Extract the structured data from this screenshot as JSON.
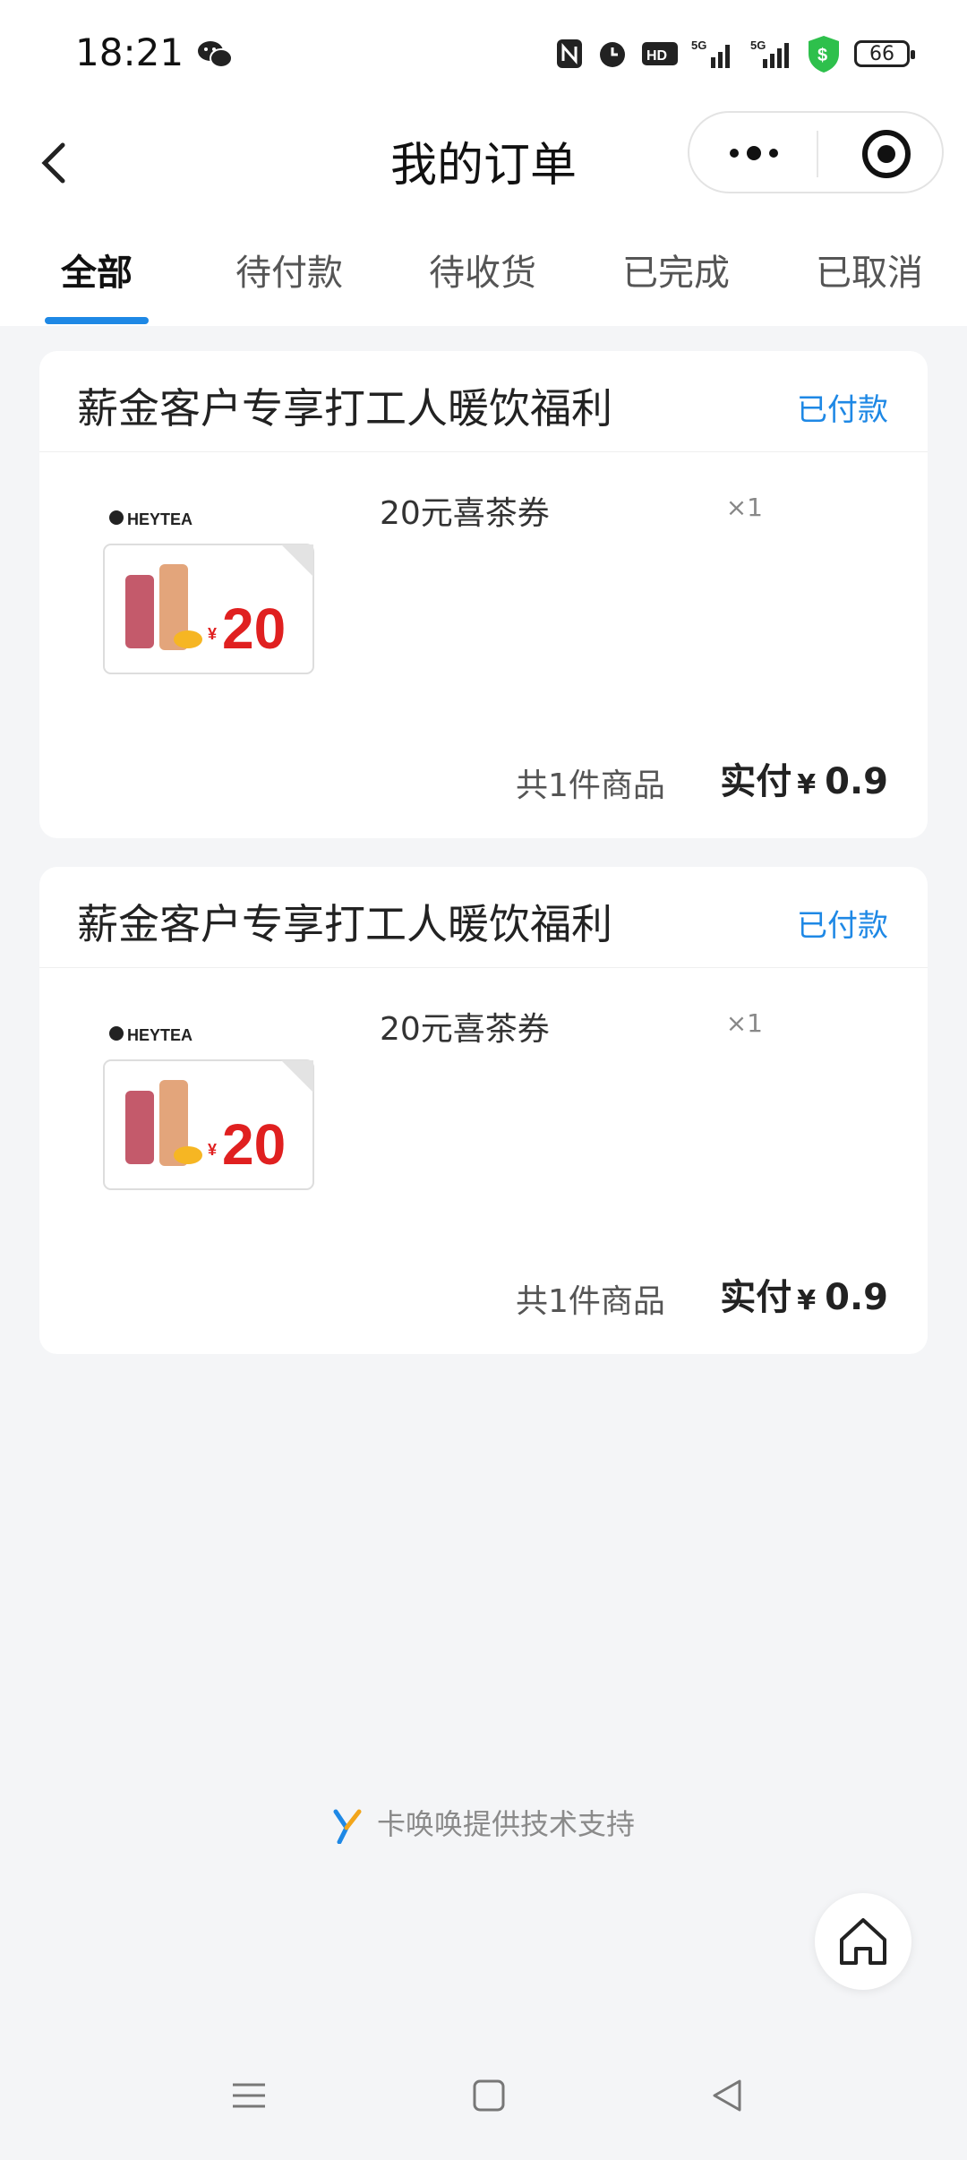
{
  "status_bar": {
    "time": "18:21",
    "battery": "66",
    "network": [
      "5G",
      "5G"
    ],
    "hd_label": "HD"
  },
  "nav": {
    "title": "我的订单",
    "back_icon": "chevron-left-icon",
    "more_icon": "more-dots-icon",
    "close_icon": "target-icon"
  },
  "tabs": [
    {
      "label": "全部",
      "active": true
    },
    {
      "label": "待付款"
    },
    {
      "label": "待收货"
    },
    {
      "label": "已完成"
    },
    {
      "label": "已取消"
    }
  ],
  "orders": [
    {
      "shop": "薪金客户专享打工人暖饮福利",
      "status": "已付款",
      "item": {
        "name": "20元喜茶券",
        "qty": "×1",
        "brand": "HEYTEA",
        "coupon_value": "20",
        "currency": "¥"
      },
      "count_text": "共1件商品",
      "paid_label": "实付",
      "currency": "¥",
      "amount": "0.9"
    },
    {
      "shop": "薪金客户专享打工人暖饮福利",
      "status": "已付款",
      "item": {
        "name": "20元喜茶券",
        "qty": "×1",
        "brand": "HEYTEA",
        "coupon_value": "20",
        "currency": "¥"
      },
      "count_text": "共1件商品",
      "paid_label": "实付",
      "currency": "¥",
      "amount": "0.9"
    }
  ],
  "footer": {
    "text": "卡唤唤提供技术支持"
  },
  "colors": {
    "accent": "#1e88e5",
    "background": "#f4f5f7",
    "coupon_red": "#e02020"
  }
}
